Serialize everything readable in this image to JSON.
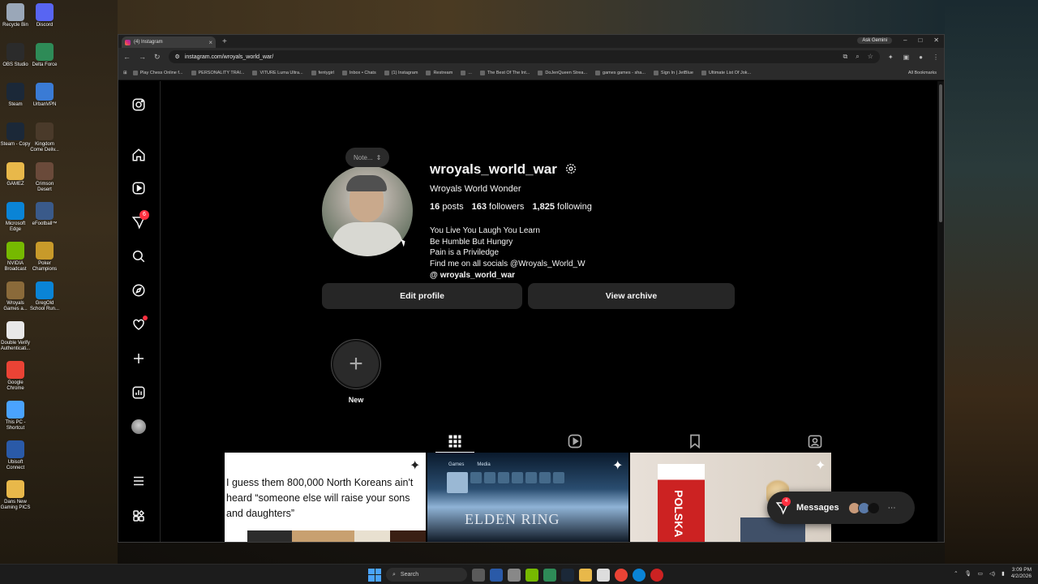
{
  "desktop": {
    "icons": [
      {
        "label": "Recycle Bin",
        "color": "#9aa7b8"
      },
      {
        "label": "Discord",
        "color": "#5865f2"
      },
      {
        "label": "OBS Studio",
        "color": "#2b2b2b"
      },
      {
        "label": "Delta Force",
        "color": "#2e8b57"
      },
      {
        "label": "Steam",
        "color": "#1b2838"
      },
      {
        "label": "UrbanVPN",
        "color": "#3a7bd5"
      },
      {
        "label": "Steam - Copy",
        "color": "#1b2838"
      },
      {
        "label": "Kingdom Come Deliv...",
        "color": "#4a3a2a"
      },
      {
        "label": "GAMEZ",
        "color": "#e8b84a"
      },
      {
        "label": "Crimson Desert",
        "color": "#6a4a3a"
      },
      {
        "label": "Microsoft Edge",
        "color": "#0a84d6"
      },
      {
        "label": "eFootball™",
        "color": "#3a5a8a"
      },
      {
        "label": "NVIDIA Broadcast",
        "color": "#76b900"
      },
      {
        "label": "Poker Champions",
        "color": "#c89a2a"
      },
      {
        "label": "Wroyals Games a...",
        "color": "#8a6a3a"
      },
      {
        "label": "GregOld School Run...",
        "color": "#0a84d6"
      },
      {
        "label": "Double Verify Authenticati...",
        "color": "#e8e8e8"
      },
      {
        "label": "Google Chrome",
        "color": "#ea4335"
      },
      {
        "label": "This PC - Shortcut",
        "color": "#4aa3ff"
      },
      {
        "label": "Ubisoft Connect",
        "color": "#2a5aa8"
      },
      {
        "label": "Dans New Gaming PICS",
        "color": "#e8b84a"
      }
    ]
  },
  "browser": {
    "tab_title": "(4) Instagram",
    "tab_close": "×",
    "new_tab": "+",
    "ask_gemini": "Ask Gemini",
    "url": "instagram.com/wroyals_world_war/",
    "bookmarks": [
      "Play Chess Online f...",
      "PERSONALITY TRAI...",
      "VITURE Luma Ultra...",
      "fentygirl",
      "Inbox • Chats",
      "(1) Instagram",
      "Restream",
      "...",
      "The Best Of The Int...",
      "DoJenQueen Strea...",
      "games games - sha...",
      "Sign In | JetBlue",
      "Ultimate List Of Jok..."
    ],
    "all_bookmarks": "All Bookmarks"
  },
  "instagram": {
    "sidebar": {
      "notifications_badge": "6"
    },
    "profile": {
      "note": "Note...",
      "username": "wroyals_world_war",
      "full_name": "Wroyals World Wonder",
      "posts_count": "16",
      "posts_label": "posts",
      "followers_count": "163",
      "followers_label": "followers",
      "following_count": "1,825",
      "following_label": "following",
      "bio_lines": [
        "You Live You Laugh You Learn",
        "Be Humble But Hungry",
        "Pain is a Priviledge",
        "Find me on all socials @Wroyals_World_W"
      ],
      "threads_handle": "wroyals_world_war",
      "edit_profile": "Edit profile",
      "view_archive": "View archive",
      "highlight_new": "New"
    },
    "posts": [
      {
        "caption": "I guess them 800,000 North Koreans ain't heard “someone else will raise your sons and daughters”"
      },
      {
        "menu_games": "Games",
        "menu_media": "Media",
        "title": "ELDEN RING"
      },
      {
        "flag_text": "POLSKA"
      }
    ],
    "messages": {
      "label": "Messages",
      "badge": "4"
    }
  },
  "taskbar": {
    "search": "Search",
    "time": "3:09 PM",
    "date": "4/2/2026"
  }
}
